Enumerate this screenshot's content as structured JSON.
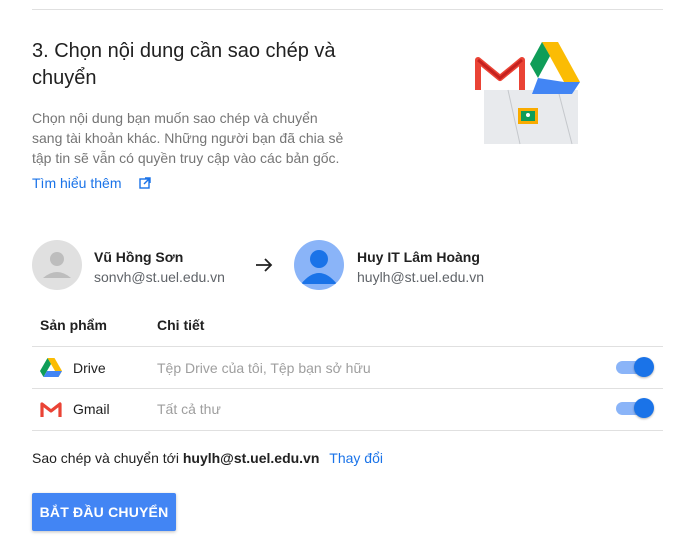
{
  "step": {
    "title_line1": "3. Chọn nội dung cần sao chép và",
    "title_line2": "chuyển",
    "description_line1": "Chọn nội dung bạn muốn sao chép và chuyển",
    "description_line2": "sang tài khoản khác. Những người bạn đã chia sẻ",
    "description_line3": "tập tin sẽ vẫn có quyền truy cập vào các bản gốc.",
    "learn_more": "Tìm hiểu thêm"
  },
  "accounts": {
    "source": {
      "name": "Vũ Hồng Sơn",
      "email": "sonvh@st.uel.edu.vn",
      "avatar_icon": "person-icon"
    },
    "target": {
      "name": "Huy IT Lâm Hoàng",
      "email": "huylh@st.uel.edu.vn",
      "avatar_icon": "person-icon"
    }
  },
  "table": {
    "headers": [
      "Sản phẩm",
      "Chi tiết"
    ],
    "rows": [
      {
        "icon": "drive-icon",
        "product": "Drive",
        "detail": "Tệp Drive của tôi, Tệp bạn sở hữu",
        "enabled": true
      },
      {
        "icon": "gmail-icon",
        "product": "Gmail",
        "detail": "Tất cả thư",
        "enabled": true
      }
    ]
  },
  "summary": {
    "prefix": "Sao chép và chuyển tới",
    "email": "huylh@st.uel.edu.vn",
    "change_link": "Thay đổi"
  },
  "actions": {
    "start_label": "BẮT ĐẦU CHUYỂN"
  },
  "colors": {
    "accent": "#1a73e8",
    "button": "#4285f4",
    "toggle_track": "#8ab4f8"
  }
}
